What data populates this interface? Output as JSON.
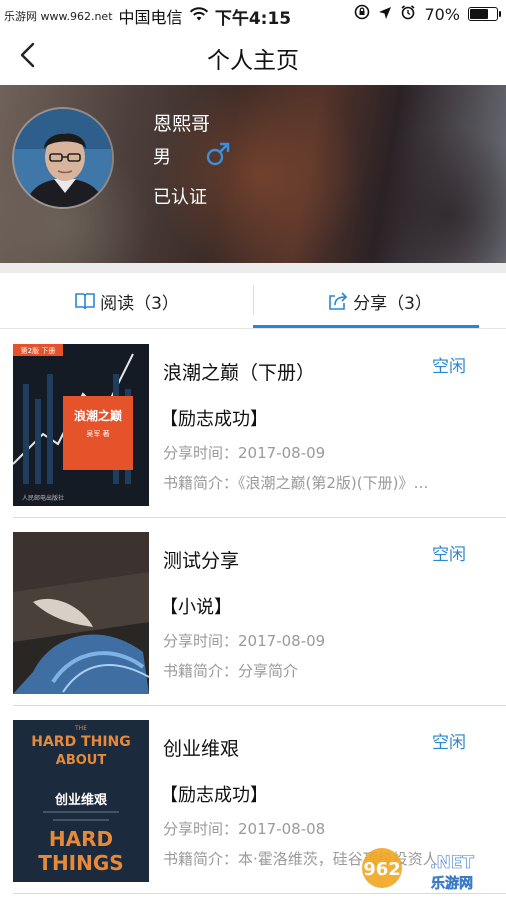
{
  "status_bar": {
    "watermark": "乐游网 www.962.net",
    "carrier": "中国电信",
    "time": "下午4:15",
    "battery": "70%",
    "battery_level": 0.7
  },
  "nav": {
    "title": "个人主页",
    "back_icon": "chevron-left-icon"
  },
  "profile": {
    "name": "恩熙哥",
    "gender": "男",
    "gender_icon": "male-symbol-icon",
    "gender_icon_color": "#3b8fe0",
    "verified": "已认证"
  },
  "tabs": [
    {
      "label": "阅读（3）",
      "icon": "book-icon",
      "active": false
    },
    {
      "label": "分享（3）",
      "icon": "share-icon",
      "active": true
    }
  ],
  "accent_color": "#2a86d1",
  "books": [
    {
      "title": "浪潮之巅（下册）",
      "status": "空闲",
      "category": "【励志成功】",
      "time_label": "分享时间：",
      "time": "2017-08-09",
      "intro_label": "书籍简介：",
      "intro": "《浪潮之巅(第2版)(下册)》…",
      "cover": {
        "title": "浪潮之巅",
        "author": "吴军 著",
        "tag": "第2版 下册",
        "publisher": "人民邮电出版社"
      }
    },
    {
      "title": "测试分享",
      "status": "空闲",
      "category": "【小说】",
      "time_label": "分享时间：",
      "time": "2017-08-09",
      "intro_label": "书籍简介：",
      "intro": "分享简介"
    },
    {
      "title": "创业维艰",
      "status": "空闲",
      "category": "【励志成功】",
      "time_label": "分享时间：",
      "time": "2017-08-08",
      "intro_label": "书籍简介：",
      "intro": "本·霍洛维茨，硅谷顶级投资人",
      "cover": {
        "top": "THE",
        "line1": "HARD THING",
        "line2": "ABOUT",
        "cn_title": "创业维艰",
        "line3": "HARD",
        "line4": "THINGS"
      }
    }
  ],
  "site_logo": {
    "number": "962",
    "suffix": ".NET",
    "name": "乐游网"
  }
}
